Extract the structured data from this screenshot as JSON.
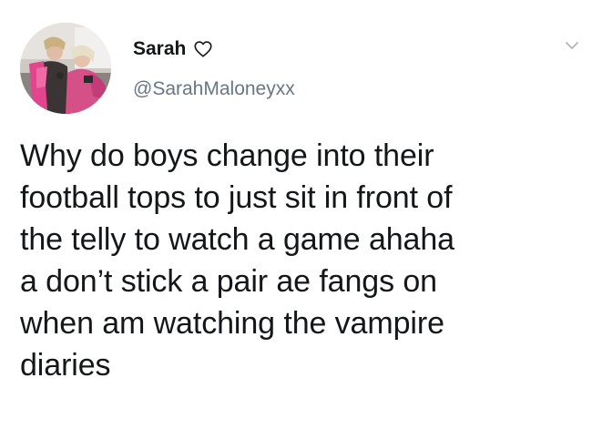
{
  "tweet": {
    "display_name": "Sarah",
    "handle": "@SarahMaloneyxx",
    "text": "Why do boys change into their\nfootball tops to just sit in front of\nthe telly to watch a game ahaha\na don’t stick a pair ae fangs on\nwhen am watching the vampire\ndiaries"
  },
  "icons": {
    "name_badge": "heart-outline-icon",
    "menu": "chevron-down-icon"
  },
  "colors": {
    "text": "#14171a",
    "secondary_text": "#657786",
    "background": "#ffffff",
    "chevron": "#aab8c2"
  }
}
